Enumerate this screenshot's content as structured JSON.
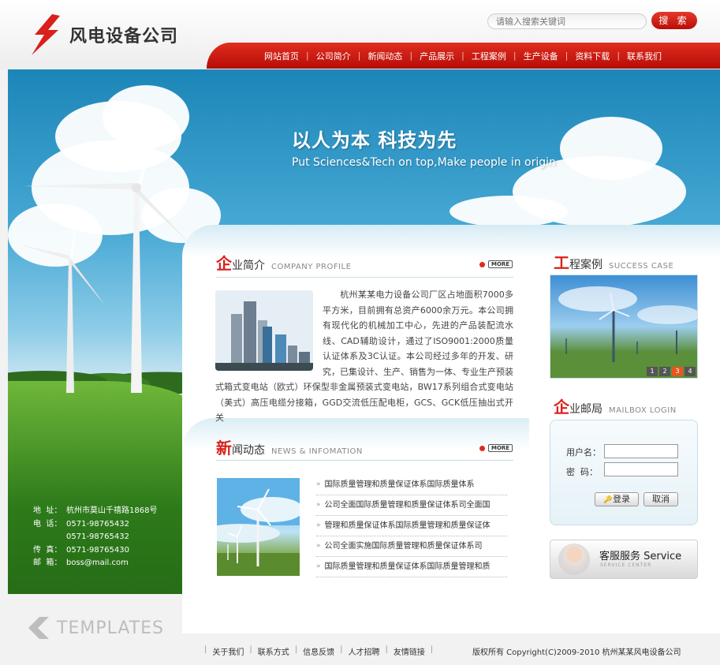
{
  "header": {
    "logo_text": "风电设备公司",
    "search": {
      "placeholder": "请输入搜索关键词",
      "button_label": "搜 索"
    },
    "nav": [
      "网站首页",
      "公司简介",
      "新闻动态",
      "产品展示",
      "工程案例",
      "生产设备",
      "资料下载",
      "联系我们"
    ]
  },
  "banner": {
    "slogan_cn": "以人为本 科技为先",
    "slogan_en": "Put Sciences&Tech on top,Make people in origin"
  },
  "profile": {
    "title_first": "企",
    "title_rest": "业简介",
    "title_en": "COMPANY PROFILE",
    "more_label": "MORE",
    "text": "杭州某某电力设备公司厂区占地面积7000多平方米，目前拥有总资产6000余万元。本公司拥有现代化的机械加工中心，先进的产品装配流水线、CAD辅助设计，通过了ISO9001:2000质量认证体系及3C认证。本公司经过多年的开发、研究，已集设计、生产、销售为一体、专业生产预装式箱式变电站（欧式）环保型非金属预装式变电站，BW17系列组合式变电站（美式）高压电缆分接箱，GGD交流低压配电柜，GCS、GCK低压抽出式开关"
  },
  "news": {
    "title_first": "新",
    "title_rest": "闻动态",
    "title_en": "NEWS & INFOMATION",
    "more_label": "MORE",
    "items": [
      "国际质量管理和质量保证体系国际质量体系",
      "公司全面国际质量管理和质量保证体系司全面国",
      "管理和质量保证体系国际质量管理和质量保证体",
      "公司全面实施国际质量管理和质量保证体系司",
      "国际质量管理和质量保证体系国际质量管理和质"
    ]
  },
  "cases": {
    "title_first": "工",
    "title_rest": "程案例",
    "title_en": "SUCCESS CASE",
    "pages": [
      "1",
      "2",
      "3",
      "4"
    ],
    "active_page": 3
  },
  "mailbox": {
    "title_first": "企",
    "title_rest": "业邮局",
    "title_en": "MAILBOX LOGIN",
    "username_label": "用户名：",
    "password_label": "密  码：",
    "login_label": "登录",
    "cancel_label": "取消"
  },
  "service": {
    "title": "客服服务  Service",
    "subtitle": "SERVICE CENTER"
  },
  "contact": {
    "address_label": "地  址：",
    "address": "杭州市莫山千禧路1868号",
    "phone_label": "电  话：",
    "phone1": "0571-98765432",
    "phone2": "0571-98765432",
    "fax_label": "传  真：",
    "fax": "0571-98765430",
    "email_label": "邮  箱：",
    "email": "boss@mail.com"
  },
  "templates_text": "TEMPLATES",
  "footer": {
    "links": [
      "关于我们",
      "联系方式",
      "信息反馈",
      "人才招聘",
      "友情链接"
    ],
    "copyright": "版权所有 Copyright(C)2009-2010 杭州某某风电设备公司"
  },
  "colors": {
    "brand_red": "#d9201b",
    "sky_blue": "#1c86b8"
  }
}
